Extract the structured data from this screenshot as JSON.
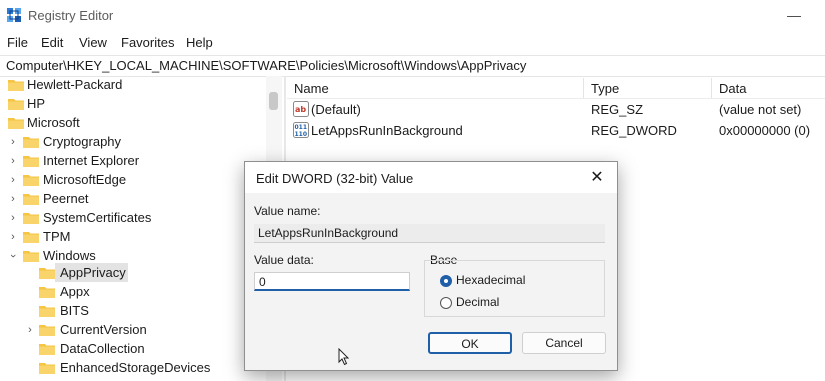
{
  "window": {
    "title": "Registry Editor",
    "minimize_glyph": "—"
  },
  "menu": [
    "File",
    "Edit",
    "View",
    "Favorites",
    "Help"
  ],
  "address": "Computer\\HKEY_LOCAL_MACHINE\\SOFTWARE\\Policies\\Microsoft\\Windows\\AppPrivacy",
  "tree": {
    "items": [
      {
        "label": "Hewlett-Packard"
      },
      {
        "label": "HP"
      },
      {
        "label": "Microsoft"
      },
      {
        "label": "Cryptography"
      },
      {
        "label": "Internet Explorer"
      },
      {
        "label": "MicrosoftEdge"
      },
      {
        "label": "Peernet"
      },
      {
        "label": "SystemCertificates"
      },
      {
        "label": "TPM"
      },
      {
        "label": "Windows"
      },
      {
        "label": "AppPrivacy"
      },
      {
        "label": "Appx"
      },
      {
        "label": "BITS"
      },
      {
        "label": "CurrentVersion"
      },
      {
        "label": "DataCollection"
      },
      {
        "label": "EnhancedStorageDevices"
      }
    ],
    "selected": "AppPrivacy"
  },
  "list": {
    "columns": [
      "Name",
      "Type",
      "Data"
    ],
    "rows": [
      {
        "name": "(Default)",
        "type": "REG_SZ",
        "data": "(value not set)",
        "icon": "string-value-icon"
      },
      {
        "name": "LetAppsRunInBackground",
        "type": "REG_DWORD",
        "data": "0x00000000 (0)",
        "icon": "binary-value-icon"
      }
    ]
  },
  "dialog": {
    "title": "Edit DWORD (32-bit) Value",
    "value_name_label": "Value name:",
    "value_name": "LetAppsRunInBackground",
    "value_data_label": "Value data:",
    "value_data": "0",
    "base_label": "Base",
    "base_options": [
      "Hexadecimal",
      "Decimal"
    ],
    "base_selected": "Hexadecimal",
    "ok_label": "OK",
    "cancel_label": "Cancel",
    "close_glyph": "✕"
  },
  "colors": {
    "folder": "#f5c543",
    "accent": "#1f5fa8",
    "selection": "#e3e3e3"
  }
}
